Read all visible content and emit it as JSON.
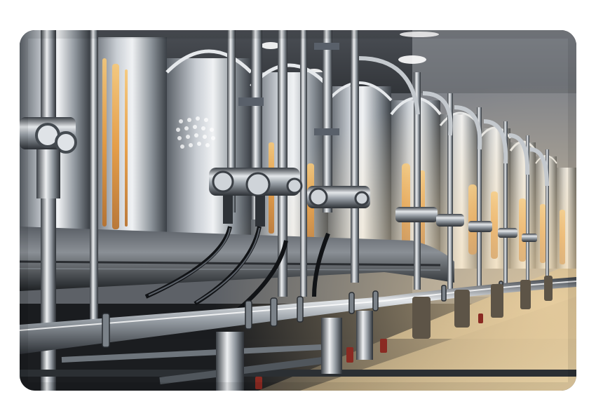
{
  "image": {
    "subject": "industrial-pipeline-photo",
    "colors": {
      "background": "#ffffff",
      "steel_light": "#d9dde2",
      "steel_mid": "#8c939b",
      "steel_dark": "#2f3439",
      "warm_light": "#f2b65a",
      "floor": "#c9b48e",
      "ceiling": "#3a3d42"
    }
  }
}
